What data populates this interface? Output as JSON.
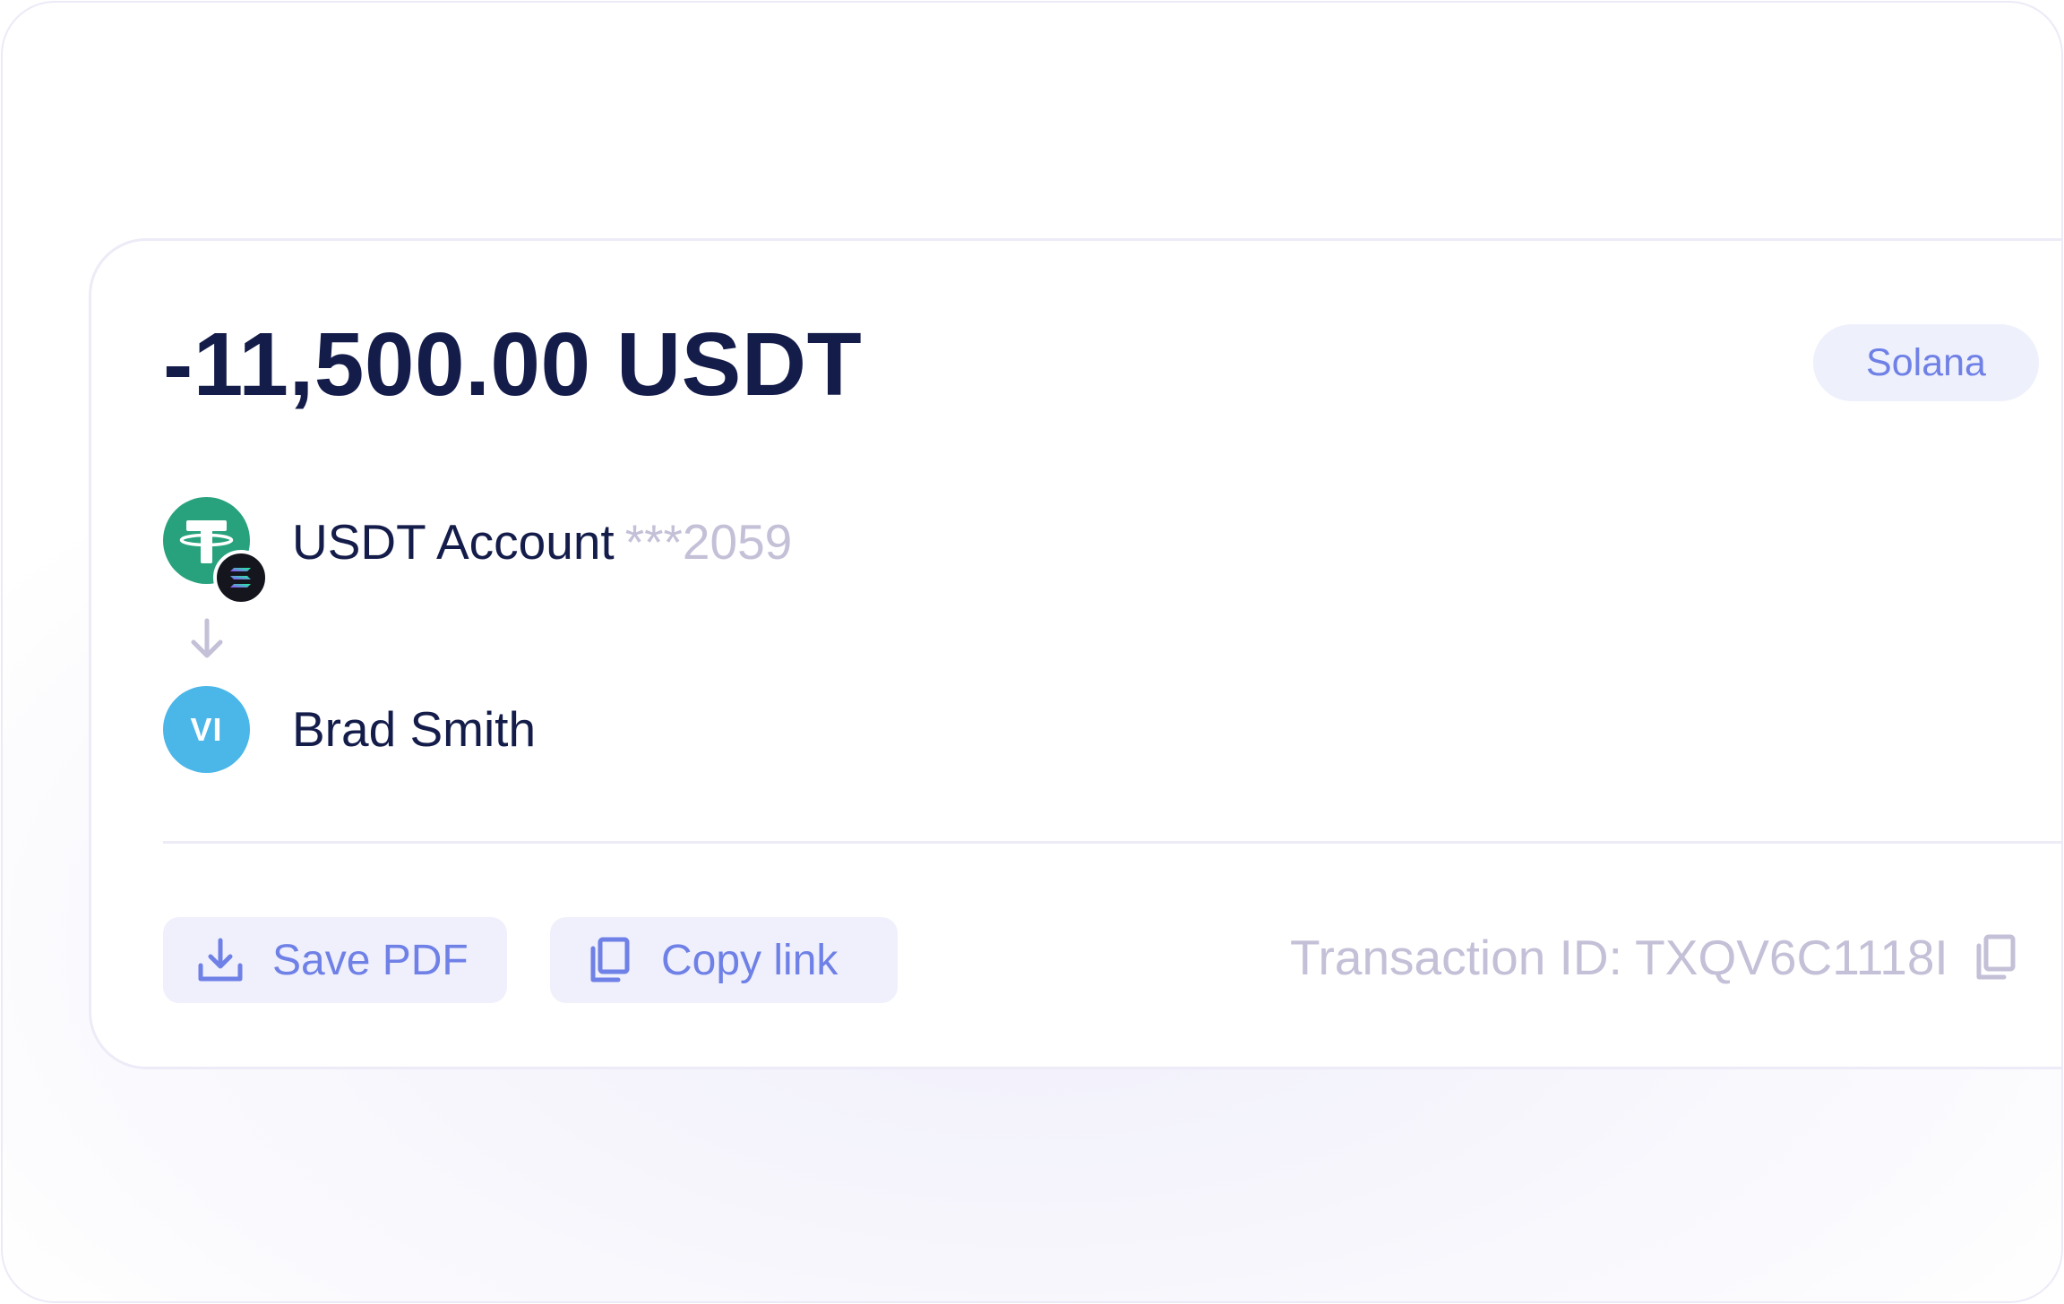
{
  "transaction": {
    "amount": "-11,500.00 USDT",
    "network": "Solana",
    "from": {
      "label": "USDT Account",
      "masked_number": "***2059",
      "token_icon": "tether-icon",
      "chain_icon": "solana-icon"
    },
    "to": {
      "initials": "VI",
      "name": "Brad Smith"
    }
  },
  "actions": {
    "save_pdf": "Save PDF",
    "copy_link": "Copy link"
  },
  "transaction_id": {
    "label": "Transaction ID: TXQV6C1118I"
  },
  "colors": {
    "accent": "#6f80e6",
    "accent_bg": "#eff0fc",
    "text_primary": "#141c4a",
    "text_muted": "#c3c0d7",
    "tether_green": "#27a27c",
    "avatar_blue": "#4bb6e8"
  }
}
